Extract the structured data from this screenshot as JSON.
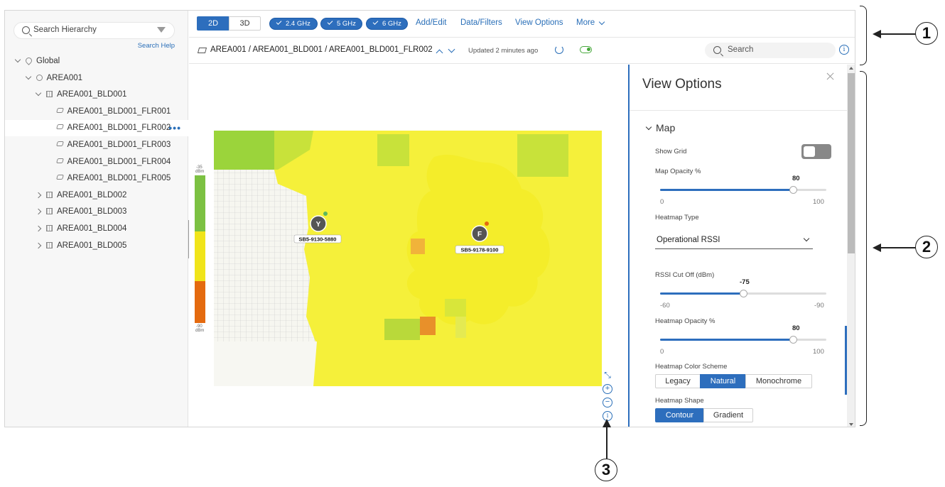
{
  "sidebar": {
    "search_placeholder": "Search Hierarchy",
    "search_help": "Search Help",
    "tree": [
      {
        "label": "Global",
        "level": 0,
        "expanded": true,
        "icon": "pin-icon"
      },
      {
        "label": "AREA001",
        "level": 1,
        "expanded": true,
        "icon": "area-icon"
      },
      {
        "label": "AREA001_BLD001",
        "level": 2,
        "expanded": true,
        "icon": "building-icon"
      },
      {
        "label": "AREA001_BLD001_FLR001",
        "level": 3,
        "icon": "floor-icon"
      },
      {
        "label": "AREA001_BLD001_FLR002",
        "level": 3,
        "icon": "floor-icon",
        "selected": true
      },
      {
        "label": "AREA001_BLD001_FLR003",
        "level": 3,
        "icon": "floor-icon"
      },
      {
        "label": "AREA001_BLD001_FLR004",
        "level": 3,
        "icon": "floor-icon"
      },
      {
        "label": "AREA001_BLD001_FLR005",
        "level": 3,
        "icon": "floor-icon"
      },
      {
        "label": "AREA001_BLD002",
        "level": 2,
        "expanded": false,
        "icon": "building-icon"
      },
      {
        "label": "AREA001_BLD003",
        "level": 2,
        "expanded": false,
        "icon": "building-icon"
      },
      {
        "label": "AREA001_BLD004",
        "level": 2,
        "expanded": false,
        "icon": "building-icon"
      },
      {
        "label": "AREA001_BLD005",
        "level": 2,
        "expanded": false,
        "icon": "building-icon"
      }
    ],
    "more_dots": "•••"
  },
  "toolbar": {
    "view_2d": "2D",
    "view_3d": "3D",
    "band_24": "2.4 GHz",
    "band_5": "5 GHz",
    "band_6": "6 GHz",
    "add_edit": "Add/Edit",
    "data_filters": "Data/Filters",
    "view_options": "View Options",
    "more": "More"
  },
  "crumbbar": {
    "breadcrumb": "AREA001 / AREA001_BLD001 / AREA001_BLD001_FLR002",
    "updated": "Updated 2 minutes ago",
    "search_placeholder": "Search",
    "info": "i"
  },
  "map": {
    "legend_top": "-35\ndBm",
    "legend_bottom": "-90\ndBm",
    "ap1_label": "SB5-9130-5880",
    "ap2_label": "SB5-9178-9100",
    "colors": {
      "yellow": "#f5f03a",
      "green": "#9bd43b",
      "orange": "#e3761b",
      "legend_green": "#7cc142",
      "legend_yellow": "#f0e41a",
      "legend_orange": "#e46a0f"
    }
  },
  "view_options": {
    "title": "View Options",
    "section": "Map",
    "show_grid_label": "Show Grid",
    "show_grid": false,
    "map_opacity_label": "Map Opacity %",
    "map_opacity": {
      "value": "80",
      "min": "0",
      "max": "100",
      "fraction": 0.8
    },
    "heatmap_type_label": "Heatmap Type",
    "heatmap_type": "Operational RSSI",
    "rssi_cutoff_label": "RSSI Cut Off (dBm)",
    "rssi_cutoff": {
      "value": "-75",
      "min": "-60",
      "max": "-90",
      "fraction": 0.5
    },
    "heatmap_opacity_label": "Heatmap Opacity %",
    "heatmap_opacity": {
      "value": "80",
      "min": "0",
      "max": "100",
      "fraction": 0.8
    },
    "color_scheme_label": "Heatmap Color Scheme",
    "color_schemes": [
      "Legacy",
      "Natural",
      "Monochrome"
    ],
    "color_scheme_active": "Natural",
    "shape_label": "Heatmap Shape",
    "shapes": [
      "Contour",
      "Gradient"
    ],
    "shape_active": "Contour"
  },
  "callouts": {
    "c1": "1",
    "c2": "2",
    "c3": "3"
  }
}
